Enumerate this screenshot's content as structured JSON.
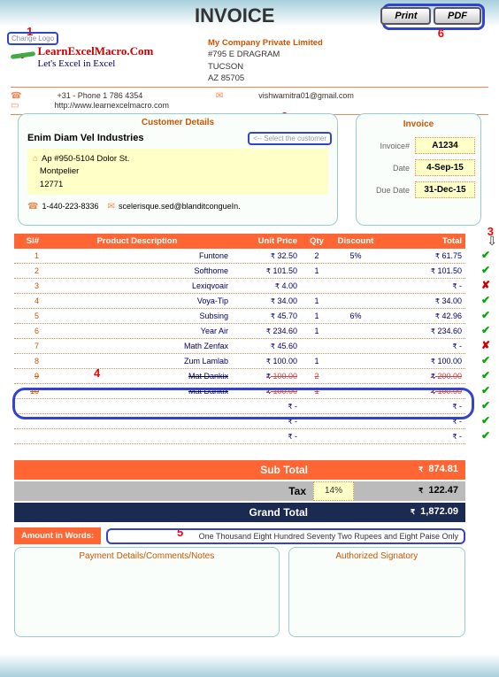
{
  "title": "INVOICE",
  "buttons": {
    "print": "Print",
    "pdf": "PDF",
    "change_logo": "Change Logo"
  },
  "annotations": {
    "a1": "1",
    "a2": "2",
    "a3": "3",
    "a4": "4",
    "a5": "5",
    "a6": "6"
  },
  "logo": {
    "line1": "LearnExcelMacro.Com",
    "line2": "Let's Excel in Excel"
  },
  "company": {
    "name": "My Company Private Limited",
    "addr1": "#795 E DRAGRAM",
    "city": "TUCSON",
    "zip": "AZ 85705"
  },
  "contact": {
    "phone": "+31 - Phone 1 786 4354",
    "email": "vishwamitra01@gmail.com",
    "web": "http://www.learnexcelmacro.com"
  },
  "customer": {
    "header": "Customer Details",
    "select_label": "<-- Select the customer",
    "name": "Enim Diam Vel Industries",
    "addr1": "Ap #950-5104 Dolor St.",
    "addr2": "Montpelier",
    "addr3": "12771",
    "phone": "1-440-223-8336",
    "email": "scelerisque.sed@blanditcongueIn."
  },
  "invoice": {
    "header": "Invoice",
    "num_label": "Invoice#",
    "num": "A1234",
    "date_label": "Date",
    "date": "4-Sep-15",
    "due_label": "Due Date",
    "due": "31-Dec-15"
  },
  "table": {
    "headers": [
      "Sl#",
      "Product Description",
      "Unit Price",
      "Qty",
      "Discount",
      "Total"
    ],
    "rows": [
      {
        "sl": "1",
        "desc": "Funtone",
        "up": "32.50",
        "qty": "2",
        "disc": "5%",
        "tot": "61.75",
        "strike": false
      },
      {
        "sl": "2",
        "desc": "Softhome",
        "up": "101.50",
        "qty": "1",
        "disc": "",
        "tot": "101.50",
        "strike": false
      },
      {
        "sl": "3",
        "desc": "Lexiqvoair",
        "up": "4.00",
        "qty": "",
        "disc": "",
        "tot": "-",
        "strike": false
      },
      {
        "sl": "4",
        "desc": "Voya-Tip",
        "up": "34.00",
        "qty": "1",
        "disc": "",
        "tot": "34.00",
        "strike": false
      },
      {
        "sl": "5",
        "desc": "Subsing",
        "up": "45.70",
        "qty": "1",
        "disc": "6%",
        "tot": "42.96",
        "strike": false
      },
      {
        "sl": "6",
        "desc": "Year Air",
        "up": "234.60",
        "qty": "1",
        "disc": "",
        "tot": "234.60",
        "strike": false
      },
      {
        "sl": "7",
        "desc": "Math Zenfax",
        "up": "45.60",
        "qty": "",
        "disc": "",
        "tot": "-",
        "strike": false
      },
      {
        "sl": "8",
        "desc": "Zum Lamlab",
        "up": "100.00",
        "qty": "1",
        "disc": "",
        "tot": "100.00",
        "strike": false
      },
      {
        "sl": "9",
        "desc": "Mat Dankix",
        "up": "100.00",
        "qty": "2",
        "disc": "",
        "tot": "200.00",
        "strike": true
      },
      {
        "sl": "10",
        "desc": "Mat Dankix",
        "up": "100.00",
        "qty": "1",
        "disc": "",
        "tot": "100.00",
        "strike": true
      },
      {
        "sl": "",
        "desc": "",
        "up": "-",
        "qty": "",
        "disc": "",
        "tot": "-",
        "strike": false
      },
      {
        "sl": "",
        "desc": "",
        "up": "-",
        "qty": "",
        "disc": "",
        "tot": "-",
        "strike": false
      },
      {
        "sl": "",
        "desc": "",
        "up": "-",
        "qty": "",
        "disc": "",
        "tot": "-",
        "strike": false
      }
    ]
  },
  "checks": [
    "g",
    "g",
    "r",
    "g",
    "g",
    "g",
    "r",
    "g",
    "g",
    "g",
    "g",
    "g",
    "g"
  ],
  "totals": {
    "sub_label": "Sub Total",
    "sub": "874.81",
    "tax_label": "Tax",
    "tax_pct": "14%",
    "tax": "122.47",
    "grand_label": "Grand Total",
    "grand": "1,872.09"
  },
  "amount_words": {
    "label": "Amount in Words:",
    "value": "One Thousand Eight Hundred Seventy Two Rupees and Eight Paise Only"
  },
  "footer": {
    "notes": "Payment Details/Comments/Notes",
    "signatory": "Authorized Signatory"
  }
}
